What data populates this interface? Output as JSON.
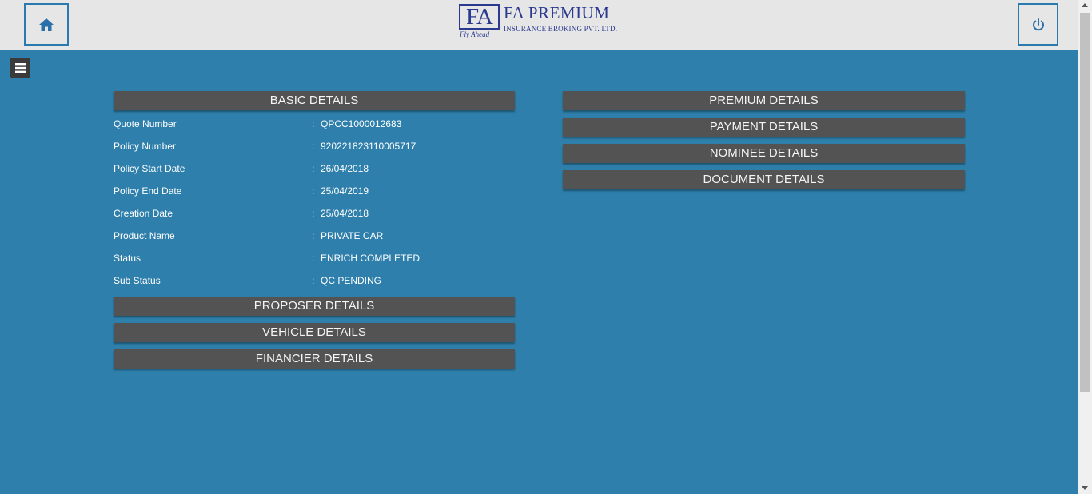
{
  "header": {
    "logo_mark": "FA",
    "logo_tagline": "Fly Ahead",
    "logo_title": "FA PREMIUM",
    "logo_subtitle": "INSURANCE BROKING PVT. LTD.",
    "home_icon": "home-icon",
    "power_icon": "power-icon"
  },
  "menu_icon": "hamburger-menu-icon",
  "colors": {
    "background": "#2e7fab",
    "header": "#e6e6e6",
    "section_bar": "#535353",
    "brand": "#2b3a8f"
  },
  "basic_details": {
    "title": "BASIC DETAILS",
    "colon": ":",
    "rows": [
      {
        "label": "Quote Number",
        "value": "QPCC1000012683"
      },
      {
        "label": "Policy Number",
        "value": "920221823110005717"
      },
      {
        "label": "Policy Start Date",
        "value": "26/04/2018"
      },
      {
        "label": "Policy End Date",
        "value": "25/04/2019"
      },
      {
        "label": "Creation Date",
        "value": "25/04/2018"
      },
      {
        "label": "Product Name",
        "value": "PRIVATE CAR"
      },
      {
        "label": "Status",
        "value": "ENRICH COMPLETED"
      },
      {
        "label": "Sub Status",
        "value": "QC PENDING"
      }
    ]
  },
  "left_sections": [
    "PROPOSER DETAILS",
    "VEHICLE DETAILS",
    "FINANCIER DETAILS"
  ],
  "right_sections": [
    "PREMIUM DETAILS",
    "PAYMENT DETAILS",
    "NOMINEE DETAILS",
    "DOCUMENT DETAILS"
  ]
}
